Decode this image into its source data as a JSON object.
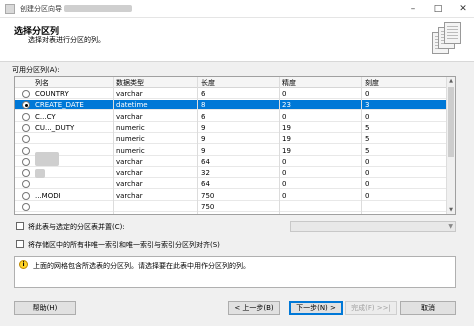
{
  "window": {
    "title": "创建分区向导 -",
    "minimize": "–",
    "maximize": "□",
    "close": "✕"
  },
  "header": {
    "title": "选择分区列",
    "subtitle": "选择对表进行分区的列。"
  },
  "grid": {
    "label": "可用分区列(A):",
    "columns": [
      "列名",
      "数据类型",
      "长度",
      "精度",
      "刻度"
    ],
    "rows": [
      {
        "selected": false,
        "name": "COUNTRY",
        "type": "varchar",
        "length": "6",
        "precision": "0",
        "scale": "0"
      },
      {
        "selected": true,
        "name": "CREATE_DATE",
        "type": "datetime",
        "length": "8",
        "precision": "23",
        "scale": "3"
      },
      {
        "selected": false,
        "name": "C...CY",
        "type": "varchar",
        "length": "6",
        "precision": "0",
        "scale": "0"
      },
      {
        "selected": false,
        "name": "CU..._DUTY",
        "type": "numeric",
        "length": "9",
        "precision": "19",
        "scale": "5"
      },
      {
        "selected": false,
        "name": "",
        "type": "numeric",
        "length": "9",
        "precision": "19",
        "scale": "5"
      },
      {
        "selected": false,
        "name": "",
        "type": "numeric",
        "length": "9",
        "precision": "19",
        "scale": "5"
      },
      {
        "selected": false,
        "name": "",
        "type": "varchar",
        "length": "64",
        "precision": "0",
        "scale": "0"
      },
      {
        "selected": false,
        "name": "",
        "type": "varchar",
        "length": "32",
        "precision": "0",
        "scale": "0"
      },
      {
        "selected": false,
        "name": "",
        "type": "varchar",
        "length": "64",
        "precision": "0",
        "scale": "0"
      },
      {
        "selected": false,
        "name": "...MODI",
        "type": "varchar",
        "length": "750",
        "precision": "0",
        "scale": "0"
      },
      {
        "selected": false,
        "name": "",
        "type": "",
        "length": "750",
        "precision": "",
        "scale": ""
      }
    ]
  },
  "options": {
    "colocate_label": "将此表与选定的分区表并置(C):",
    "align_indexes_label": "将存储区中的所有非唯一索引和唯一索引与索引分区列对齐(S)"
  },
  "info": {
    "text": "上面的网格包含所选表的分区列。请选择要在此表中用作分区列的列。"
  },
  "buttons": {
    "help": "帮助(H)",
    "back": "< 上一步(B)",
    "next": "下一步(N) >",
    "finish": "完成(F) >>|",
    "cancel": "取消"
  },
  "colors": {
    "selection": "#0078d7",
    "background": "#f0f0f0"
  }
}
